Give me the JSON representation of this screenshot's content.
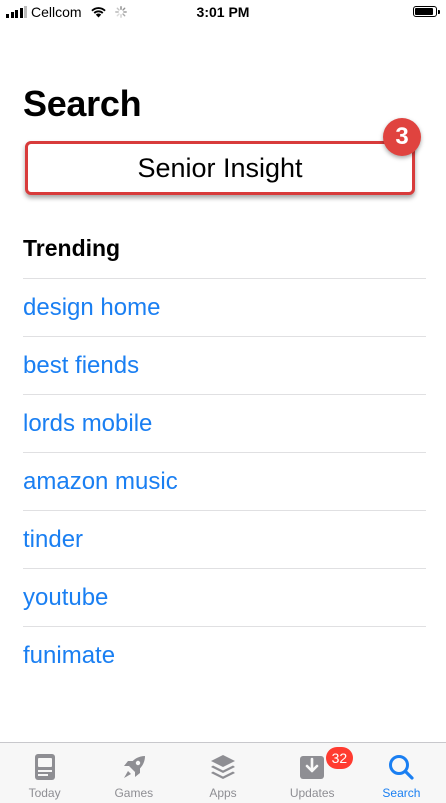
{
  "status_bar": {
    "carrier": "Cellcom",
    "time": "3:01 PM",
    "battery_level": 0.9
  },
  "page": {
    "title": "Search"
  },
  "search": {
    "value": "Senior Insight"
  },
  "step_badge": "3",
  "trending": {
    "heading": "Trending",
    "items": [
      "design home",
      "best fiends",
      "lords mobile",
      "amazon music",
      "tinder",
      "youtube",
      "funimate"
    ]
  },
  "tab_bar": {
    "tabs": [
      {
        "label": "Today",
        "icon": "today-icon"
      },
      {
        "label": "Games",
        "icon": "rocket-icon"
      },
      {
        "label": "Apps",
        "icon": "layers-icon"
      },
      {
        "label": "Updates",
        "icon": "download-tray-icon",
        "badge": "32"
      },
      {
        "label": "Search",
        "icon": "search-icon",
        "active": true
      }
    ]
  },
  "colors": {
    "link": "#1a7ff2",
    "annotation": "#e0433f",
    "badge": "#ff3b30",
    "inactive_tab": "#8e8e93"
  }
}
